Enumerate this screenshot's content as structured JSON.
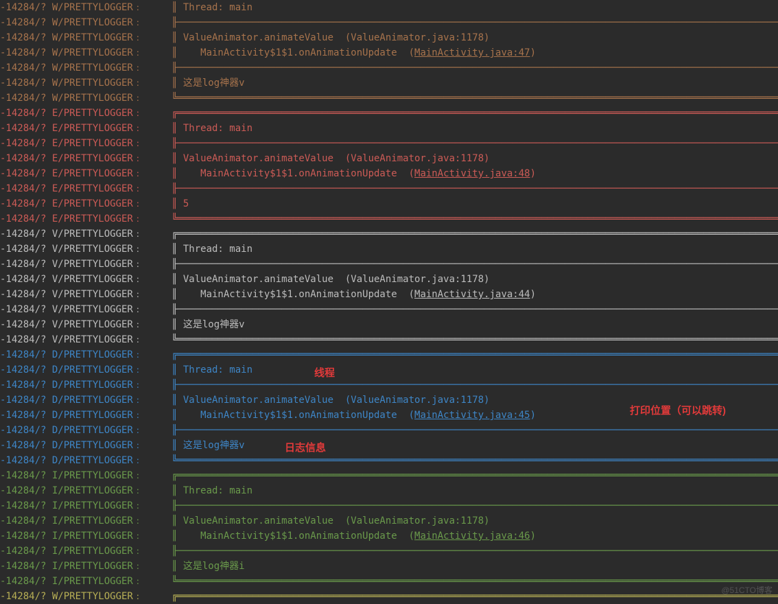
{
  "prefix": "-14284/? ",
  "tag": "/PRETTYLOGGER﹕",
  "box": {
    "top": "╔════════════════════════════════════════════════════════════════════════════════════════════════════════",
    "mid": "╟────────────────────────────────────────────────────────────────────────────────────────────────────────",
    "bot": "╚════════════════════════════════════════════════════════════════════════════════════════════════════════",
    "side": "║ "
  },
  "common": {
    "thread": "Thread: main",
    "stack1": "ValueAnimator.animateValue  (ValueAnimator.java:1178)",
    "stack2a": "   MainActivity$1$1.onAnimationUpdate  (",
    "stack2c": ")"
  },
  "blocks": [
    {
      "level": "W",
      "cls": "lvl-w",
      "link": "MainActivity.java:47",
      "msg": "这是log神器v",
      "startOffset": 1
    },
    {
      "level": "E",
      "cls": "lvl-e",
      "link": "MainActivity.java:48",
      "msg": "5",
      "startOffset": 0
    },
    {
      "level": "V",
      "cls": "lvl-v",
      "link": "MainActivity.java:44",
      "msg": "这是log神器v",
      "startOffset": 0
    },
    {
      "level": "D",
      "cls": "lvl-d",
      "link": "MainActivity.java:45",
      "msg": "这是log神器v",
      "startOffset": 0
    },
    {
      "level": "I",
      "cls": "lvl-i",
      "link": "MainActivity.java:46",
      "msg": "这是log神器i",
      "startOffset": 0
    }
  ],
  "trailing": {
    "level": "W",
    "cls": "lvl-wy"
  },
  "annotations": {
    "thread": "线程",
    "location": "打印位置（可以跳转)",
    "message": "日志信息"
  },
  "watermark": "@51CTO博客"
}
